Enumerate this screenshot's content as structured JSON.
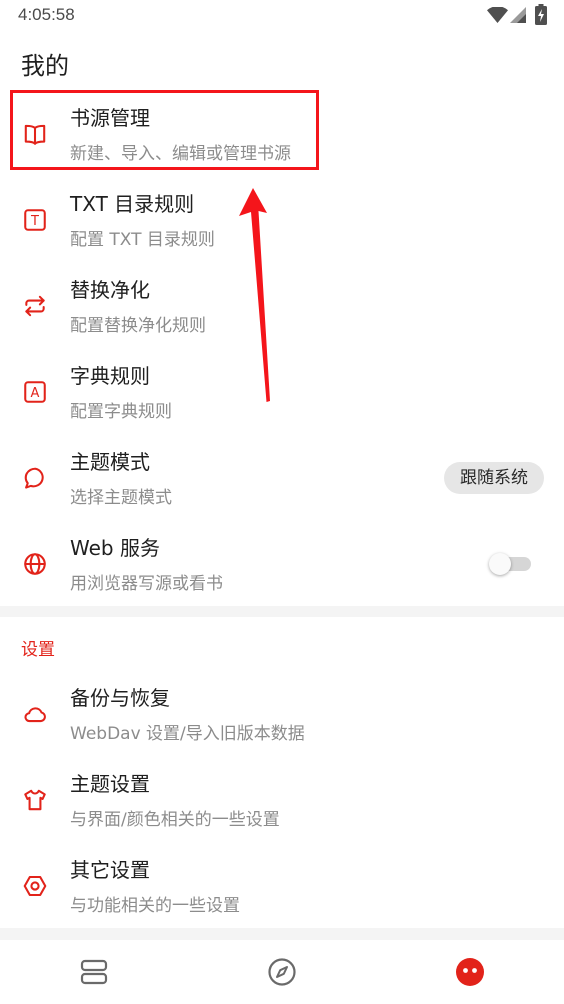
{
  "status_bar": {
    "time": "4:05:58",
    "icons": [
      "wifi-icon",
      "cell-signal-icon",
      "battery-charging-icon"
    ]
  },
  "colors": {
    "accent": "#e2231a",
    "annotation": "#f4151b",
    "title_text": "#1f1f1f",
    "subtitle_text": "#8c8c8c",
    "section_band": "#f4f4f4",
    "pill_background": "#e6e6e6",
    "nav_inactive": "#6a6a6a"
  },
  "page": {
    "title": "我的"
  },
  "main_items": [
    {
      "icon": "book-open-icon",
      "title": "书源管理",
      "subtitle": "新建、导入、编辑或管理书源",
      "highlighted": true
    },
    {
      "icon": "txt-rule-icon",
      "icon_letter": "T",
      "title": "TXT 目录规则",
      "subtitle": "配置 TXT 目录规则"
    },
    {
      "icon": "swap-arrows-icon",
      "title": "替换净化",
      "subtitle": "配置替换净化规则"
    },
    {
      "icon": "dictionary-icon",
      "icon_letter": "A",
      "title": "字典规则",
      "subtitle": "配置字典规则"
    },
    {
      "icon": "chat-bubble-icon",
      "title": "主题模式",
      "subtitle": "选择主题模式",
      "value": "跟随系统"
    },
    {
      "icon": "globe-icon",
      "title": "Web 服务",
      "subtitle": "用浏览器写源或看书",
      "toggle_on": false
    }
  ],
  "settings_section": {
    "header": "设置",
    "items": [
      {
        "icon": "cloud-icon",
        "title": "备份与恢复",
        "subtitle": "WebDav 设置/导入旧版本数据"
      },
      {
        "icon": "tshirt-icon",
        "title": "主题设置",
        "subtitle": "与界面/颜色相关的一些设置"
      },
      {
        "icon": "hex-nut-icon",
        "title": "其它设置",
        "subtitle": "与功能相关的一些设置"
      }
    ]
  },
  "bottom_nav": [
    {
      "icon": "bookshelf-icon",
      "active": false
    },
    {
      "icon": "compass-icon",
      "active": false
    },
    {
      "icon": "my-profile-icon",
      "active": true
    }
  ]
}
